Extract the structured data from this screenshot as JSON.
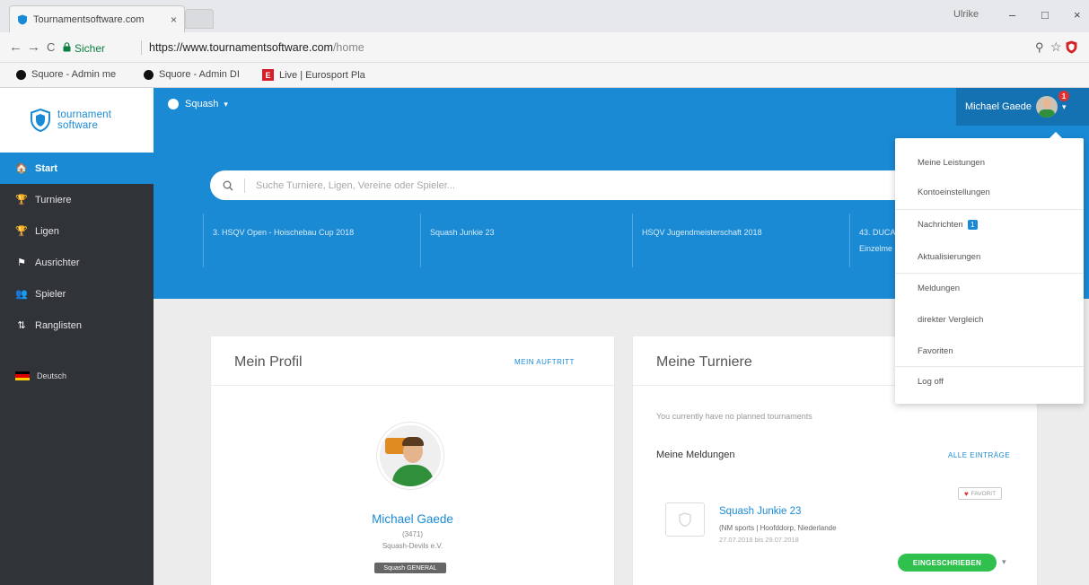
{
  "browser": {
    "tab_title": "Tournamentsoftware.com",
    "tab_close": "×",
    "window_user": "Ulrike",
    "win_min": "–",
    "win_max": "□",
    "win_close": "×",
    "back": "←",
    "forward": "→",
    "reload": "C",
    "secure_label": "Sicher",
    "url_host": "https://www.tournamentsoftware.com",
    "url_path": "/home",
    "zoom_icon": "⚲",
    "star_icon": "☆",
    "bookmarks": [
      {
        "label": "Squore - Admin me"
      },
      {
        "label": "Squore - Admin DI"
      },
      {
        "label": "Live | Eurosport Pla"
      }
    ],
    "euro_letter": "E"
  },
  "sidebar": {
    "logo_line1": "tournament",
    "logo_line2": "software",
    "items": [
      {
        "label": "Start",
        "icon": "🏠"
      },
      {
        "label": "Turniere",
        "icon": "🏆"
      },
      {
        "label": "Ligen",
        "icon": "🏆"
      },
      {
        "label": "Ausrichter",
        "icon": "⚑"
      },
      {
        "label": "Spieler",
        "icon": "👥"
      },
      {
        "label": "Ranglisten",
        "icon": "⇅"
      }
    ],
    "language": "Deutsch"
  },
  "header": {
    "sport": "Squash",
    "caret": "▾",
    "user_name": "Michael Gaede",
    "notification_count": "1",
    "search_placeholder": "Suche Turniere, Ligen, Vereine oder Spieler...",
    "featured": [
      {
        "label": "3. HSQV Open - Hoischebau Cup 2018"
      },
      {
        "label": "Squash Junkie 23"
      },
      {
        "label": "HSQV Jugendmeisterschaft 2018"
      },
      {
        "label": "43. DUCA Einzelme"
      }
    ]
  },
  "dropdown": {
    "items": [
      {
        "label": "Meine Leistungen"
      },
      {
        "label": "Kontoeinstellungen"
      },
      {
        "label": "Nachrichten"
      },
      {
        "label": "Aktualisierungen"
      },
      {
        "label": "Meldungen"
      },
      {
        "label": "direkter Vergleich"
      },
      {
        "label": "Favoriten"
      },
      {
        "label": "Log off"
      }
    ],
    "messages_badge": "1"
  },
  "profile": {
    "title": "Mein Profil",
    "link": "MEIN AUFTRITT",
    "name": "Michael Gaede",
    "id": "(3471)",
    "club": "Squash-Devils e.V.",
    "badge": "Squash GENERAL"
  },
  "tournaments": {
    "title": "Meine Turniere",
    "empty": "You currently have no planned tournaments",
    "entries_title": "Meine Meldungen",
    "all_link": "ALLE EINTRÄGE",
    "favorite": "FAVORIT",
    "heart": "♥",
    "item": {
      "name": "Squash Junkie 23",
      "location": "(NM sports | Hoofddorp, Niederlande",
      "dates": "27.07.2018 bis 29.07.2018",
      "button": "EINGESCHRIEBEN",
      "caret": "▾"
    }
  },
  "colors": {
    "brand_blue": "#1a8ad4",
    "sidebar_dark": "#303338",
    "enrolled_green": "#2fc04d"
  }
}
